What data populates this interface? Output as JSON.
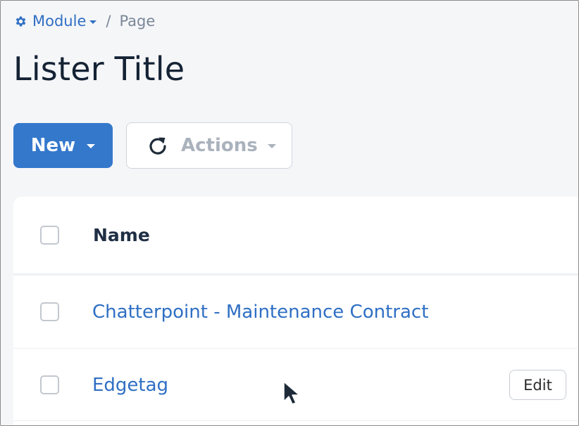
{
  "breadcrumb": {
    "module_label": "Module",
    "module_icon": "gear-icon",
    "separator": "/",
    "page_label": "Page"
  },
  "page": {
    "title": "Lister Title"
  },
  "toolbar": {
    "new_label": "New",
    "actions_label": "Actions",
    "actions_icon": "refresh-icon"
  },
  "table": {
    "columns": [
      "Name"
    ],
    "rows": [
      {
        "name": "Chatterpoint - Maintenance Contract",
        "edit_label": null
      },
      {
        "name": "Edgetag",
        "edit_label": "Edit"
      }
    ]
  },
  "colors": {
    "accent": "#3478cc",
    "link": "#2f6fc4",
    "title": "#142234",
    "muted": "#aab2bd"
  }
}
